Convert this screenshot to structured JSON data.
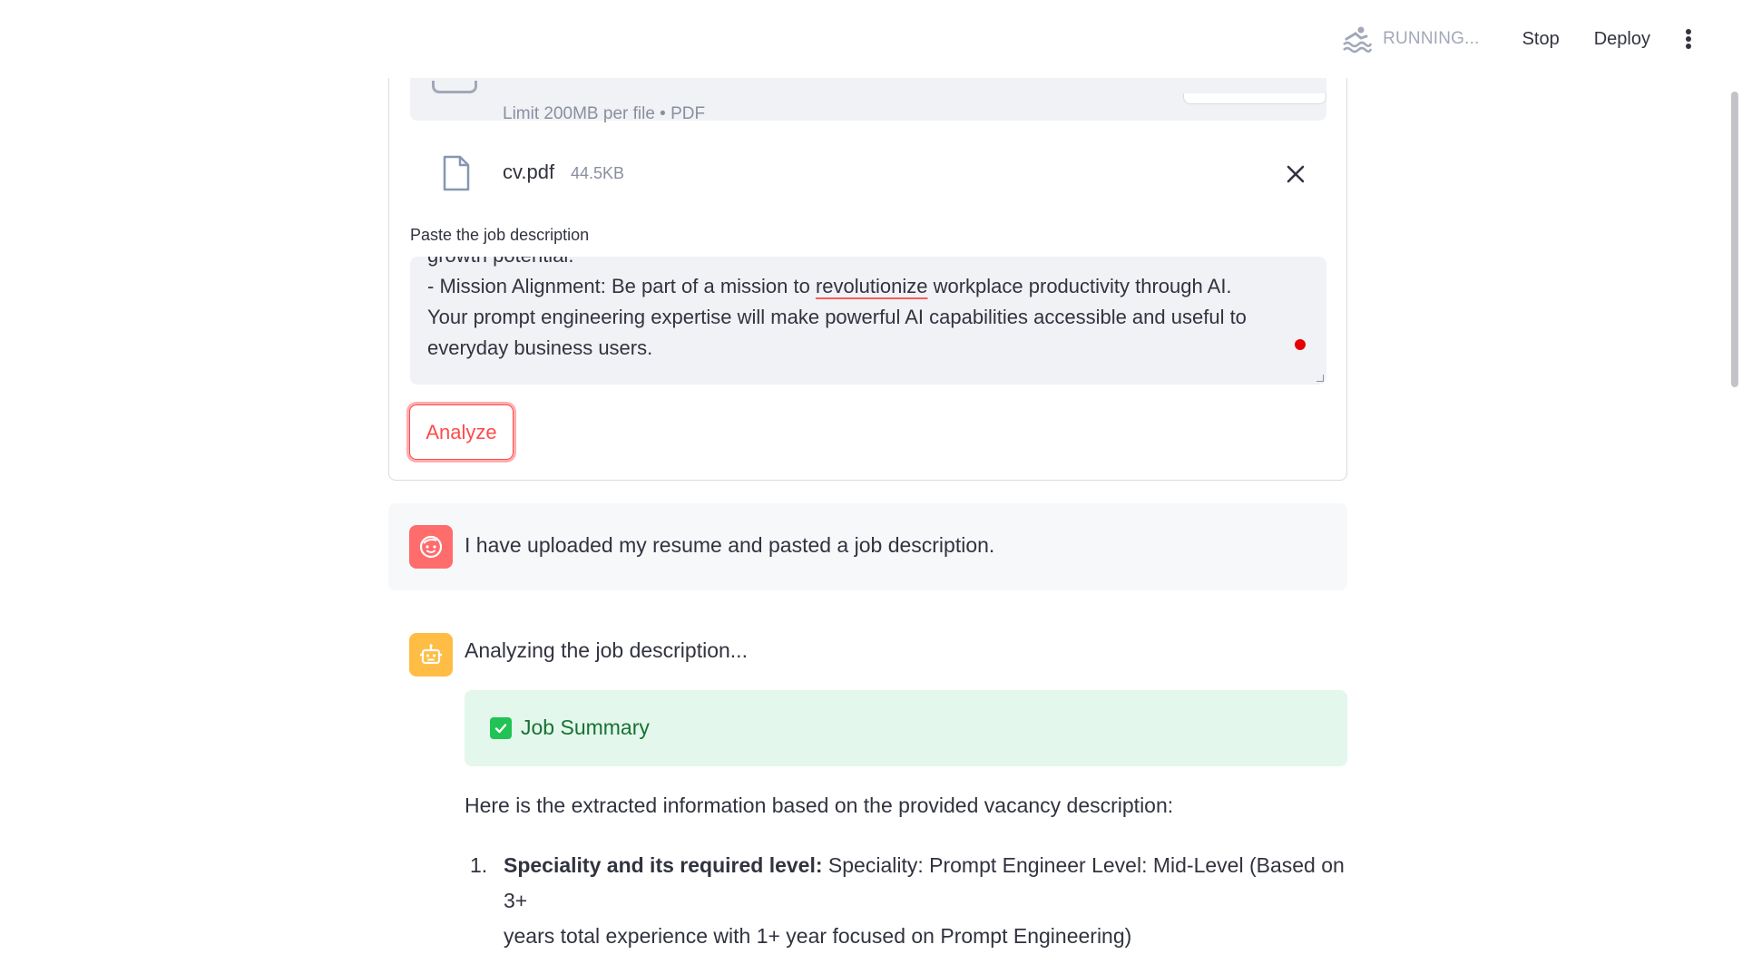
{
  "header": {
    "status_text": "RUNNING...",
    "stop_label": "Stop",
    "deploy_label": "Deploy"
  },
  "uploader": {
    "limit_text": "Limit 200MB per file • PDF",
    "file_name": "cv.pdf",
    "file_size": "44.5KB"
  },
  "job_description": {
    "label": "Paste the job description",
    "lines": {
      "l0": "growth potential.",
      "l1_pre": "- Mission Alignment: Be part of a mission to ",
      "l1_spell": "revolutionize",
      "l1_post": " workplace productivity through AI.",
      "l2": "Your prompt engineering expertise will make powerful AI capabilities accessible and useful to",
      "l3": "everyday business users."
    }
  },
  "analyze_label": "Analyze",
  "chat": {
    "user_message": "I have uploaded my resume and pasted a job description.",
    "bot_message": "Analyzing the job description...",
    "job_summary_label": "Job Summary",
    "extract_intro": "Here is the extracted information based on the provided vacancy description:",
    "list_item_1": {
      "number": "1.",
      "bold": "Speciality and its required level:",
      "text": " Speciality: Prompt Engineer Level: Mid-Level (Based on 3+",
      "text_line2": "years total experience with 1+ year focused on Prompt Engineering)"
    }
  },
  "colors": {
    "accent": "#ff4b4b",
    "user_avatar": "#ff6c6c",
    "bot_avatar": "#ffbd45",
    "success_bg": "#e3f7ec",
    "success_text": "#177233"
  }
}
